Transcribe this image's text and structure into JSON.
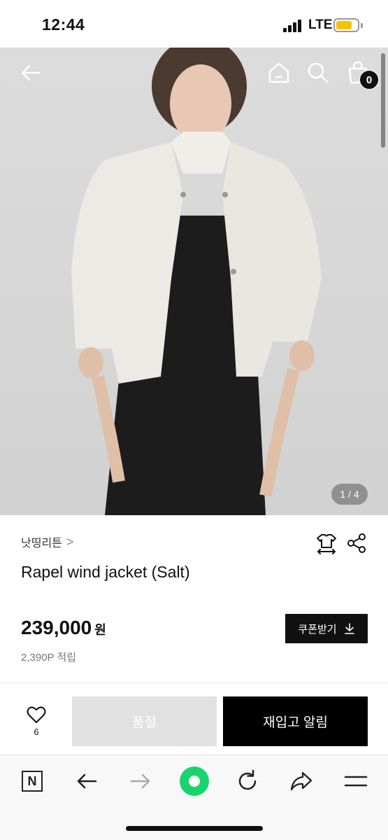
{
  "status_bar": {
    "time": "12:44",
    "network": "LTE",
    "battery_color": "#f5c400"
  },
  "header": {
    "icons": [
      "back-arrow-icon",
      "home-icon",
      "search-icon",
      "shopping-bag-icon"
    ],
    "cart_count": "0"
  },
  "gallery": {
    "page_indicator": "1 / 4"
  },
  "product": {
    "brand": "낫띵리튼",
    "brand_chevron": ">",
    "title": "Rapel wind jacket (Salt)",
    "price": "239,000",
    "currency": "원",
    "points": "2,390P 적립",
    "coupon_label": "쿠폰받기",
    "actions": [
      "size-guide-icon",
      "share-icon"
    ]
  },
  "purchase_bar": {
    "like_count": "6",
    "soldout_label": "품절",
    "restock_label": "재입고 알림"
  },
  "browser_toolbar": {
    "naver_label": "N",
    "icons": [
      "naver-icon",
      "back-icon",
      "forward-icon",
      "green-dot-icon",
      "refresh-icon",
      "share-icon",
      "menu-icon"
    ],
    "accent_color": "#19d46e"
  }
}
